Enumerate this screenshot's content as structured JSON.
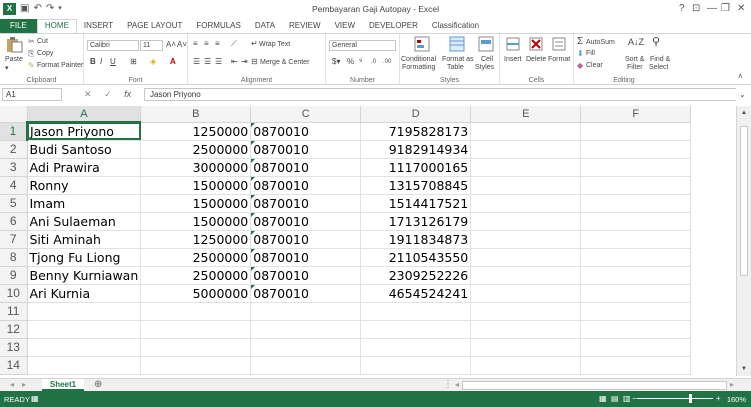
{
  "window": {
    "title": "Pembayaran Gaji Autopay - Excel",
    "controls": [
      "?",
      "⊡",
      "—",
      "❐",
      "✕"
    ]
  },
  "colors": {
    "accent": "#217346",
    "selection": "#217346",
    "error_marker": "#1e7145"
  },
  "ribbon": {
    "tabs": [
      "FILE",
      "HOME",
      "INSERT",
      "PAGE LAYOUT",
      "FORMULAS",
      "DATA",
      "REVIEW",
      "VIEW",
      "DEVELOPER",
      "Classification"
    ],
    "active_tab": "HOME",
    "clipboard": {
      "paste": "Paste",
      "cut": "Cut",
      "copy": "Copy",
      "format_painter": "Format Painter",
      "label": "Clipboard"
    },
    "font": {
      "name": "Calibri",
      "size": "11",
      "label": "Font"
    },
    "alignment": {
      "wrap_text": "Wrap Text",
      "merge_center": "Merge & Center",
      "label": "Alignment"
    },
    "number": {
      "format": "General",
      "label": "Number"
    },
    "styles": {
      "conditional": "Conditional",
      "conditional2": "Formatting",
      "format_as": "Format as",
      "format_as2": "Table",
      "cell": "Cell",
      "cell2": "Styles",
      "label": "Styles"
    },
    "cells": {
      "insert": "Insert",
      "delete": "Delete",
      "format": "Format",
      "label": "Cells"
    },
    "editing": {
      "autosum": "AutoSum",
      "fill": "Fill",
      "clear": "Clear",
      "sort": "Sort &",
      "sort2": "Filter",
      "find": "Find &",
      "find2": "Select",
      "label": "Editing"
    }
  },
  "formula_bar": {
    "name_box": "A1",
    "fx": "fx",
    "content": "Jason Priyono"
  },
  "grid": {
    "columns": [
      "A",
      "B",
      "C",
      "D",
      "E",
      "F"
    ],
    "selected_column": "A",
    "selected_row": 1,
    "row_numbers": [
      1,
      2,
      3,
      4,
      5,
      6,
      7,
      8,
      9,
      10,
      11,
      12,
      13,
      14
    ],
    "rows": [
      [
        "Jason Priyono",
        "1250000",
        "0870010",
        "7195828173"
      ],
      [
        "Budi Santoso",
        "2500000",
        "0870010",
        "9182914934"
      ],
      [
        "Adi Prawira",
        "3000000",
        "0870010",
        "1117000165"
      ],
      [
        "Ronny",
        "1500000",
        "0870010",
        "1315708845"
      ],
      [
        "Imam",
        "1500000",
        "0870010",
        "1514417521"
      ],
      [
        "Ani Sulaeman",
        "1500000",
        "0870010",
        "1713126179"
      ],
      [
        "Siti Aminah",
        "1250000",
        "0870010",
        "1911834873"
      ],
      [
        "Tjong Fu Liong",
        "2500000",
        "0870010",
        "2110543550"
      ],
      [
        "Benny Kurniawan",
        "2500000",
        "0870010",
        "2309252226"
      ],
      [
        "Ari Kurnia",
        "5000000",
        "0870010",
        "4654524241"
      ]
    ]
  },
  "sheets": {
    "tabs": [
      "Sheet1"
    ],
    "add": "⊕"
  },
  "status": {
    "ready": "READY",
    "zoom": "160%"
  }
}
